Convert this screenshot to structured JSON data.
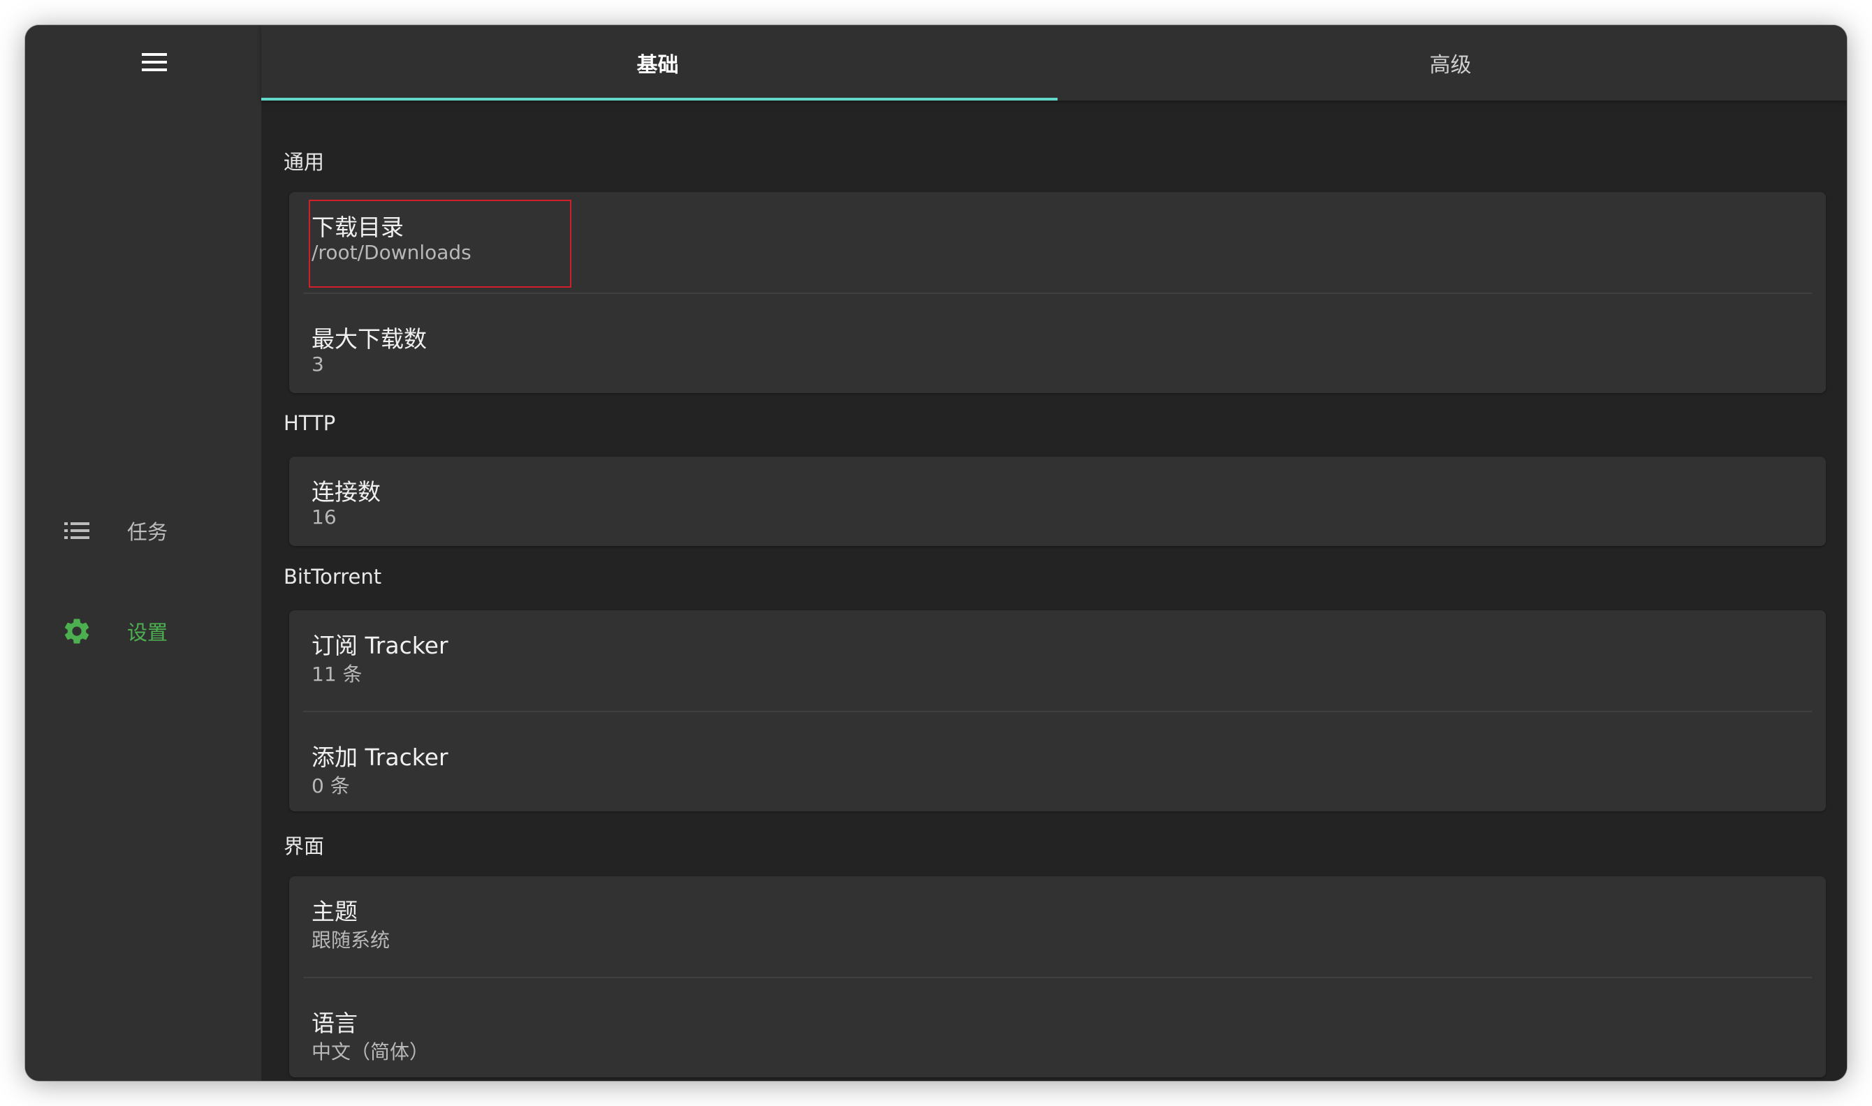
{
  "sidebar": {
    "menu_icon": "hamburger-menu-icon",
    "items": [
      {
        "label": "任务",
        "icon": "list-icon"
      },
      {
        "label": "设置",
        "icon": "gear-icon",
        "active": true
      }
    ]
  },
  "tabs": [
    {
      "label": "基础",
      "active": true
    },
    {
      "label": "高级",
      "active": false
    }
  ],
  "colors": {
    "accent": "#4caf50",
    "tab_indicator": "#64d8c8",
    "highlight": "#d0202a"
  },
  "sections": {
    "general": {
      "title": "通用",
      "items": [
        {
          "title": "下载目录",
          "value": "/root/Downloads"
        },
        {
          "title": "最大下载数",
          "value": "3"
        }
      ]
    },
    "http": {
      "title": "HTTP",
      "items": [
        {
          "title": "连接数",
          "value": "16"
        }
      ]
    },
    "bittorrent": {
      "title": "BitTorrent",
      "items": [
        {
          "title": "订阅 Tracker",
          "value": "11 条"
        },
        {
          "title": "添加 Tracker",
          "value": "0 条"
        }
      ]
    },
    "ui": {
      "title": "界面",
      "items": [
        {
          "title": "主题",
          "value": "跟随系统"
        },
        {
          "title": "语言",
          "value": "中文（简体）"
        }
      ]
    }
  }
}
